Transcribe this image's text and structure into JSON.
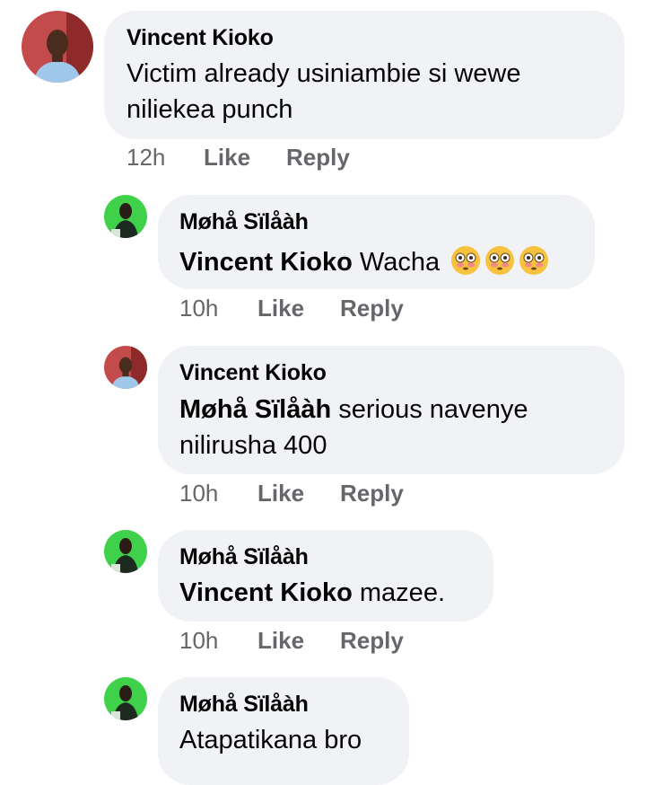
{
  "comments": [
    {
      "author": "Vincent Kioko",
      "avatar_icon": "profile-photo-vincent",
      "lines": [
        "Victim already usiniambie si wewe",
        "niliekea punch"
      ],
      "time": "12h",
      "like_label": "Like",
      "reply_label": "Reply"
    },
    {
      "author": "Møhå Sïlåàh",
      "avatar_icon": "profile-photo-moha",
      "mention": "Vincent Kioko",
      "text": " Wacha ",
      "emojis": [
        "flushed-face-emoji",
        "flushed-face-emoji",
        "flushed-face-emoji"
      ],
      "time": "10h",
      "like_label": "Like",
      "reply_label": "Reply"
    },
    {
      "author": "Vincent Kioko",
      "avatar_icon": "profile-photo-vincent",
      "mention": "Møhå Sïlåàh",
      "text": " serious navenye",
      "line2": "nilirusha 400",
      "time": "10h",
      "like_label": "Like",
      "reply_label": "Reply"
    },
    {
      "author": "Møhå Sïlåàh",
      "avatar_icon": "profile-photo-moha",
      "mention": "Vincent Kioko",
      "text": " mazee.",
      "time": "10h",
      "like_label": "Like",
      "reply_label": "Reply"
    },
    {
      "author": "Møhå Sïlåàh",
      "avatar_icon": "profile-photo-moha",
      "text": "Atapatikana bro"
    }
  ],
  "colors": {
    "bubble": "#f0f2f5",
    "meta": "#65676b",
    "text": "#050505",
    "vincent_bg": "#c0392b",
    "moha_bg": "#3fd14a"
  }
}
